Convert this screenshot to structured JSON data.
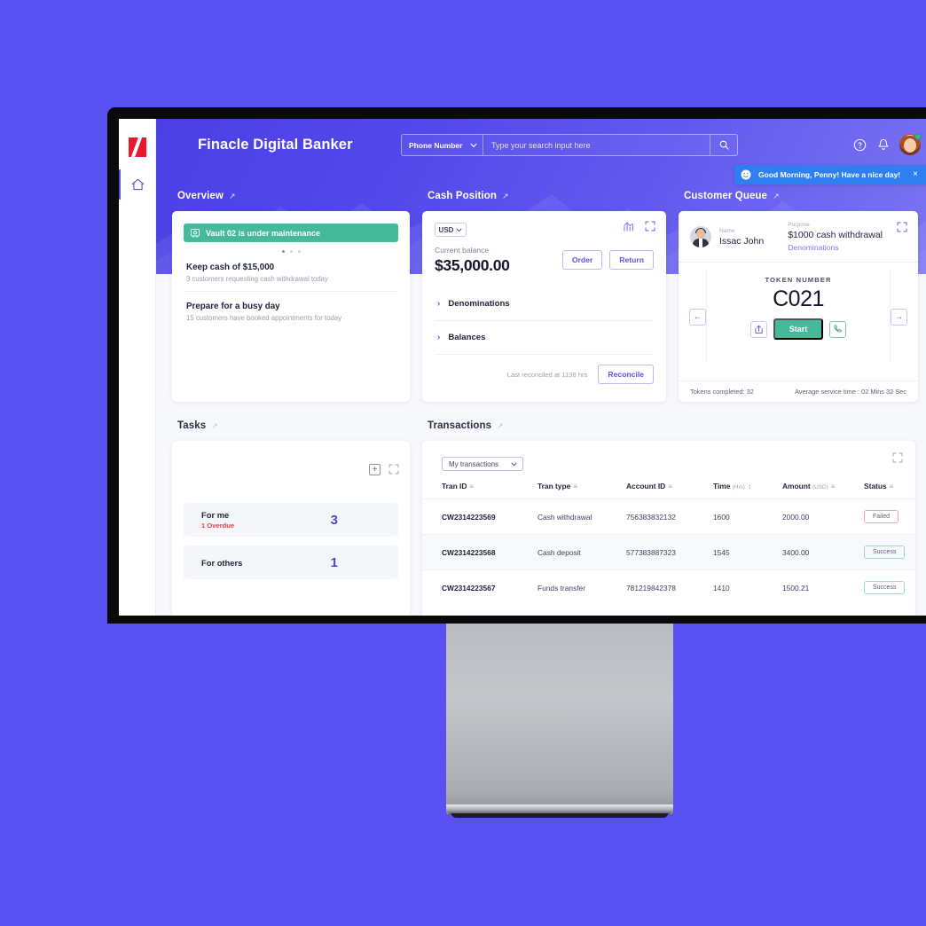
{
  "app": {
    "title": "Finacle Digital Banker",
    "logo_color": "#e8192c",
    "accent_color": "#5b52e8",
    "hero_gradient_from": "#4a3fe4",
    "hero_gradient_to": "#7b74f2"
  },
  "sidebar": {
    "home_icon": "home-icon"
  },
  "search": {
    "type_value": "Phone Number",
    "placeholder": "Type your search input here",
    "value": "",
    "chevron": "⌄",
    "search_icon": "search-icon"
  },
  "topbar": {
    "help_icon": "help-circle-icon",
    "bell_icon": "notification-bell-icon",
    "avatar": "user-avatar",
    "status_color": "#22c55e"
  },
  "greeting": {
    "text": "Good Morning, Penny! Have a nice day!",
    "close_label": "×",
    "bg_color": "#2f7ff0"
  },
  "overview": {
    "title": "Overview",
    "expand_arrow": "↗",
    "banner": {
      "text": "Vault 02 is under maintenance",
      "color": "#45b99a"
    },
    "dots": [
      true,
      false,
      false
    ],
    "items": [
      {
        "title": "Keep cash of $15,000",
        "subtitle": "3 customers requesting cash withdrawal today"
      },
      {
        "title": "Prepare for a busy day",
        "subtitle": "15 customers have booked appointments for today"
      }
    ]
  },
  "cash_position": {
    "title": "Cash Position",
    "expand_arrow": "↗",
    "currency": "USD",
    "currency_chevron": "⌄",
    "balance_label": "Current balance",
    "balance_value": "$35,000.00",
    "order_label": "Order",
    "return_label": "Return",
    "accordions": [
      {
        "label": "Denominations",
        "chevron": "›"
      },
      {
        "label": "Balances",
        "chevron": "›"
      }
    ],
    "last_reconciled": "Last reconciled at 1138 hrs",
    "reconcile_label": "Reconcile",
    "chart_icon": "bar-chart-icon",
    "expand_icon": "expand-icon"
  },
  "customer_queue": {
    "title": "Customer Queue",
    "expand_arrow": "↗",
    "name_label": "Name",
    "name_value": "Issac John",
    "purpose_label": "Purpose",
    "purpose_value": "$1000 cash withdrawal",
    "purpose_link": "Denominations",
    "token_label": "TOKEN NUMBER",
    "token_number": "C021",
    "prev_icon": "←",
    "next_icon": "→",
    "skip_icon": "share-icon",
    "start_label": "Start",
    "call_icon": "phone-icon",
    "tokens_completed": "Tokens completed: 32",
    "avg_service_time": "Average service time :  02 Mins 32 Sec"
  },
  "tasks": {
    "title": "Tasks",
    "expand_arrow": "↗",
    "add_icon": "+",
    "expand_icon": "expand-icon",
    "rows": [
      {
        "label": "For me",
        "overdue": "1 Overdue",
        "count": "3"
      },
      {
        "label": "For others",
        "overdue": "",
        "count": "1"
      }
    ]
  },
  "transactions": {
    "title": "Transactions",
    "expand_arrow": "↗",
    "filter_value": "My transactions",
    "filter_chevron": "⌄",
    "expand_icon": "expand-icon",
    "columns": [
      {
        "label": "Tran ID",
        "sub": "",
        "sort": "≡"
      },
      {
        "label": "Tran type",
        "sub": "",
        "sort": "≡"
      },
      {
        "label": "Account ID",
        "sub": "",
        "sort": "≡"
      },
      {
        "label": "Time",
        "sub": "(Hrs)",
        "sort": "↕"
      },
      {
        "label": "Amount",
        "sub": "(USD)",
        "sort": "≡"
      },
      {
        "label": "Status",
        "sub": "",
        "sort": "≡"
      }
    ],
    "rows": [
      {
        "tran_id": "CW2314223569",
        "tran_type": "Cash withdrawal",
        "account_id": "756383832132",
        "time": "1600",
        "amount": "2000.00",
        "status": "Failed",
        "status_kind": "failed"
      },
      {
        "tran_id": "CW2314223568",
        "tran_type": "Cash deposit",
        "account_id": "577383887323",
        "time": "1545",
        "amount": "3400.00",
        "status": "Success",
        "status_kind": "success"
      },
      {
        "tran_id": "CW2314223567",
        "tran_type": "Funds transfer",
        "account_id": "781219842378",
        "time": "1410",
        "amount": "1500.21",
        "status": "Success",
        "status_kind": "success"
      }
    ]
  }
}
